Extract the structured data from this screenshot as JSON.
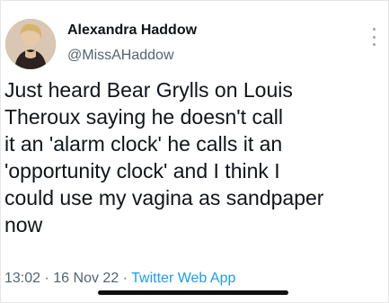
{
  "tweet": {
    "display_name": "Alexandra Haddow",
    "handle": "@MissAHaddow",
    "text": "Just heard Bear Grylls on Louis\nTheroux saying he doesn't call\nit an 'alarm clock' he calls it an\n'opportunity clock' and I think I\ncould use my vagina as sandpaper\nnow",
    "time": "13:02",
    "date": "16 Nov 22",
    "separator": "·",
    "source": "Twitter Web App"
  },
  "colors": {
    "text": "#0f1419",
    "secondary": "#536471",
    "link": "#1d9bf0"
  },
  "icons": {
    "more": "more-vertical-icon",
    "avatar": "profile-photo"
  }
}
